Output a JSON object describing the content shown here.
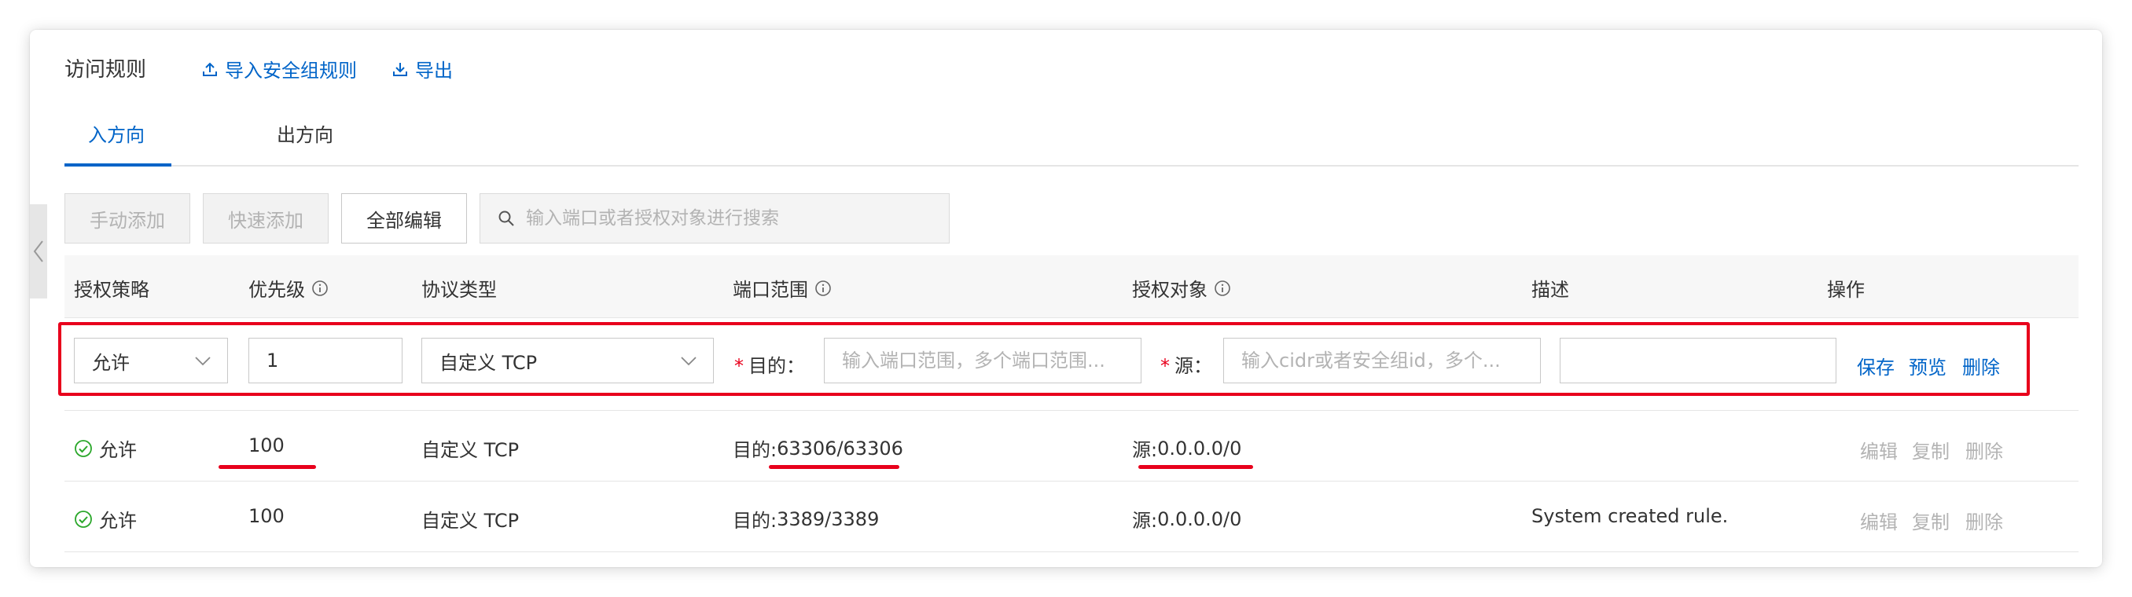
{
  "header": {
    "title": "访问规则",
    "import_label": "导入安全组规则",
    "export_label": "导出"
  },
  "tabs": [
    {
      "label": "入方向",
      "active": true
    },
    {
      "label": "出方向",
      "active": false
    }
  ],
  "toolbar": {
    "manual_add": "手动添加",
    "quick_add": "快速添加",
    "edit_all": "全部编辑",
    "search_placeholder": "输入端口或者授权对象进行搜索"
  },
  "columns": [
    "授权策略",
    "优先级",
    "协议类型",
    "端口范围",
    "授权对象",
    "描述",
    "操作"
  ],
  "edit_row": {
    "policy": "允许",
    "priority": "1",
    "protocol": "自定义 TCP",
    "dest_label": "目的：",
    "dest_placeholder": "输入端口范围，多个端口范围...",
    "source_label": "源：",
    "source_placeholder": "输入cidr或者安全组id，多个...",
    "description": "",
    "actions": [
      "保存",
      "预览",
      "删除"
    ]
  },
  "rows": [
    {
      "policy": "允许",
      "priority": "100",
      "protocol": "自定义 TCP",
      "port_prefix": "目的: ",
      "port": "63306/63306",
      "source_prefix": "源: ",
      "source": "0.0.0.0/0",
      "description": "",
      "actions": [
        "编辑",
        "复制",
        "删除"
      ]
    },
    {
      "policy": "允许",
      "priority": "100",
      "protocol": "自定义 TCP",
      "port_prefix": "目的: ",
      "port": "3389/3389",
      "source_prefix": "源: ",
      "source": "0.0.0.0/0",
      "description": "System created rule.",
      "actions": [
        "编辑",
        "复制",
        "删除"
      ]
    }
  ],
  "colors": {
    "accent": "#0064c8",
    "highlight": "#e8001c",
    "success": "#2aa72a"
  }
}
